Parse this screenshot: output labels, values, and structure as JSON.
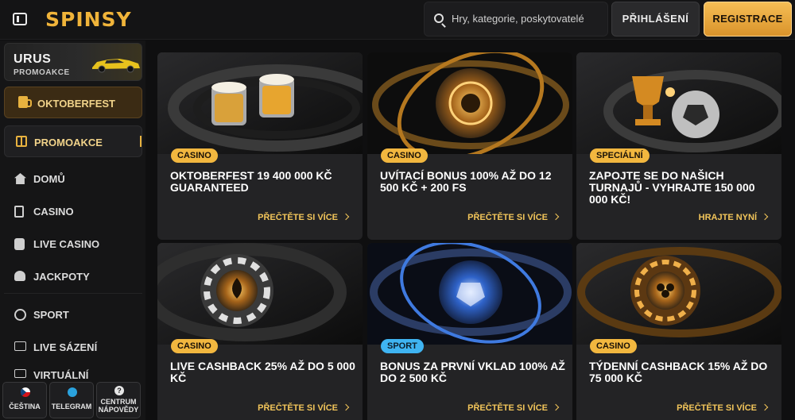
{
  "header": {
    "logo": "SPINSY",
    "search_placeholder": "Hry, kategorie, poskytovatelé",
    "login_label": "PŘIHLÁŠENÍ",
    "register_label": "REGISTRACE"
  },
  "sidebar": {
    "promo_banner": {
      "title": "URUS",
      "subtitle": "PROMOAKCE"
    },
    "featured": {
      "label": "OKTOBERFEST",
      "icon": "beer-mug-icon"
    },
    "active": {
      "label": "PROMOAKCE",
      "icon": "gift-icon"
    },
    "items": [
      {
        "label": "DOMŮ",
        "icon": "home-icon"
      },
      {
        "label": "CASINO",
        "icon": "slot-icon"
      },
      {
        "label": "LIVE CASINO",
        "icon": "live-casino-icon"
      },
      {
        "label": "JACKPOTY",
        "icon": "clover-icon"
      },
      {
        "label": "SPORT",
        "icon": "soccer-ball-icon"
      },
      {
        "label": "LIVE SÁZENÍ",
        "icon": "live-bet-icon"
      },
      {
        "label": "VIRTUÁLNÍ",
        "icon": "virtual-icon"
      }
    ],
    "footer_buttons": [
      {
        "label": "ČEŠTINA",
        "icon": "czech-flag-icon"
      },
      {
        "label": "TELEGRAM",
        "icon": "telegram-icon"
      },
      {
        "label": "CENTRUM NÁPOVĚDY",
        "icon": "help-icon"
      }
    ]
  },
  "cards": [
    {
      "badge": "CASINO",
      "title": "OKTOBERFEST 19 400 000 KČ GUARANTEED",
      "link": "PŘEČTĚTE SI VÍCE"
    },
    {
      "badge": "CASINO",
      "title": "UVÍTACÍ BONUS 100% AŽ DO 12 500 KČ + 200 FS",
      "link": "PŘEČTĚTE SI VÍCE"
    },
    {
      "badge": "SPECIÁLNÍ",
      "title": "ZAPOJTE SE DO NAŠICH TURNAJŮ - VYHRAJTE 150 000 000 KČ!",
      "link": "HRAJTE NYNÍ"
    },
    {
      "badge": "CASINO",
      "title": "LIVE CASHBACK 25% AŽ DO 5 000 KČ",
      "link": "PŘEČTĚTE SI VÍCE"
    },
    {
      "badge": "SPORT",
      "title": "BONUS ZA PRVNÍ VKLAD 100% AŽ DO 2 500 KČ",
      "link": "PŘEČTĚTE SI VÍCE"
    },
    {
      "badge": "CASINO",
      "title": "TÝDENNÍ CASHBACK 15% AŽ DO 75 000 KČ",
      "link": "PŘEČTĚTE SI VÍCE"
    }
  ],
  "colors": {
    "accent": "#f2b73f",
    "sport_badge": "#3fb4f2",
    "background": "#0f0f10",
    "card": "#232325"
  }
}
